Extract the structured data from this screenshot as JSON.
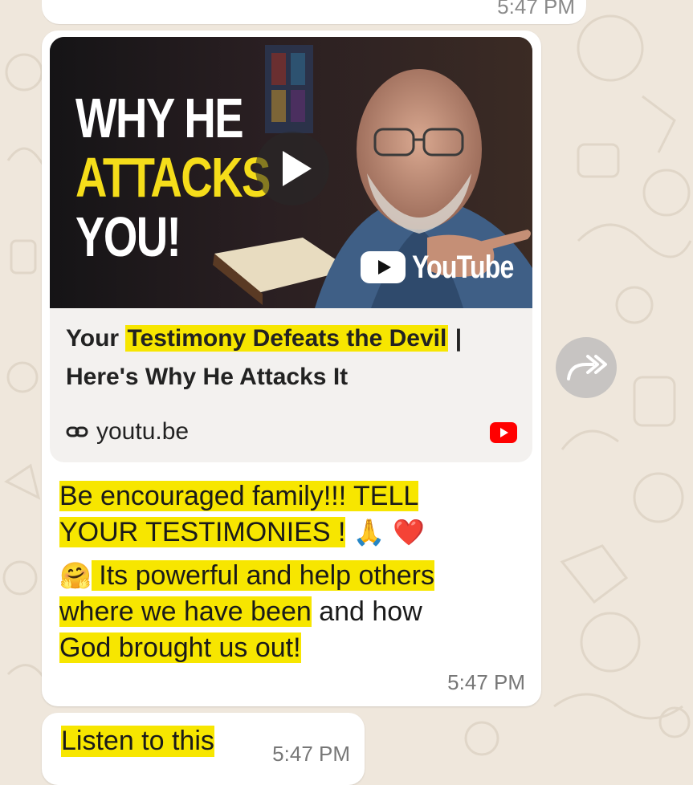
{
  "chat": {
    "previous_message": {
      "time": "5:47 PM"
    },
    "link_message": {
      "thumbnail": {
        "line1": "WHY HE",
        "line2": "ATTACKS",
        "line3": "YOU!",
        "brand": "YouTube",
        "play_icon": "play-icon",
        "brand_color": "#ff0000",
        "highlight_color": "#f5dd1a"
      },
      "title_part1": "Your ",
      "title_part2": "Testimony Defeats the Devil",
      "title_part3": " | Here's Why He Attacks It",
      "domain_icon": "link-icon",
      "domain": "youtu.be",
      "message_line1": "Be encouraged family!!! TELL",
      "message_line2": "YOUR TESTIMONIES !",
      "emoji_pray": "🙏",
      "emoji_heart": "❤️",
      "emoji_hug": "🤗",
      "message_p2_part1": " Its powerful and help others",
      "message_p2_part2": "where we have been",
      "message_p2_part3": " and how",
      "message_p2_part4": "God brought us out!",
      "time": "5:47 PM"
    },
    "forward_icon": "forward-icon",
    "last_message": {
      "text": "Listen to this",
      "time": "5:47 PM"
    },
    "colors": {
      "background": "#efe7dc",
      "bubble": "#ffffff",
      "highlight": "#f7e600"
    }
  }
}
